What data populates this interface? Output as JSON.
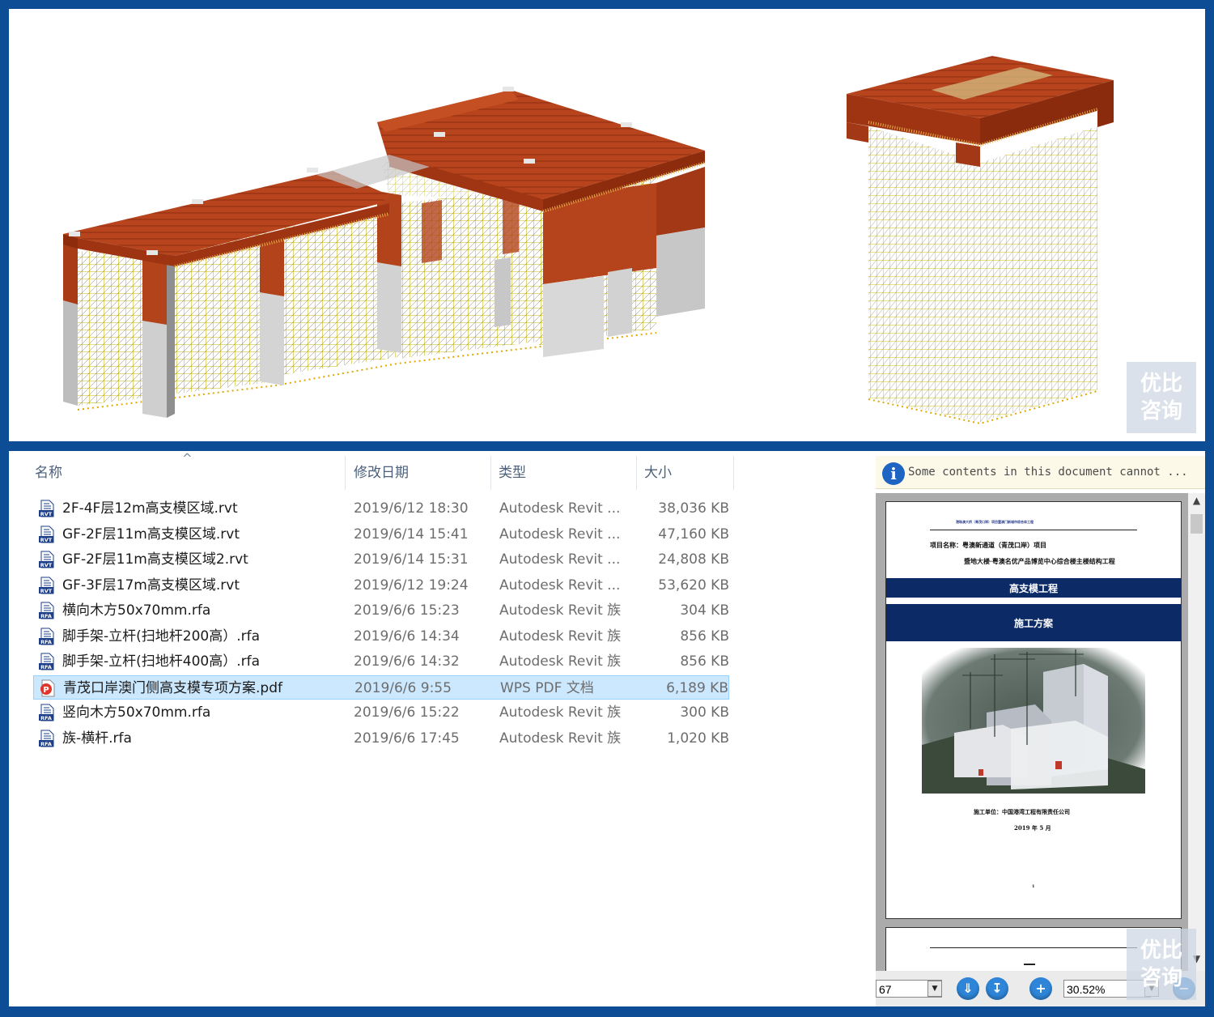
{
  "watermark": {
    "line1": "优比",
    "line2": "咨询"
  },
  "file_list": {
    "columns": {
      "name": "名称",
      "date": "修改日期",
      "type": "类型",
      "size": "大小"
    },
    "rows": [
      {
        "icon": "RVT",
        "name": "2F-4F层12m高支模区域.rvt",
        "date": "2019/6/12 18:30",
        "type": "Autodesk Revit ...",
        "size": "38,036 KB"
      },
      {
        "icon": "RVT",
        "name": "GF-2F层11m高支模区域.rvt",
        "date": "2019/6/14 15:41",
        "type": "Autodesk Revit ...",
        "size": "47,160 KB"
      },
      {
        "icon": "RVT",
        "name": "GF-2F层11m高支模区域2.rvt",
        "date": "2019/6/14 15:31",
        "type": "Autodesk Revit ...",
        "size": "24,808 KB"
      },
      {
        "icon": "RVT",
        "name": "GF-3F层17m高支模区域.rvt",
        "date": "2019/6/12 19:24",
        "type": "Autodesk Revit ...",
        "size": "53,620 KB"
      },
      {
        "icon": "RFA",
        "name": "横向木方50x70mm.rfa",
        "date": "2019/6/6 15:23",
        "type": "Autodesk Revit 族",
        "size": "304 KB"
      },
      {
        "icon": "RFA",
        "name": "脚手架-立杆(扫地杆200高）.rfa",
        "date": "2019/6/6 14:34",
        "type": "Autodesk Revit 族",
        "size": "856 KB"
      },
      {
        "icon": "RFA",
        "name": "脚手架-立杆(扫地杆400高）.rfa",
        "date": "2019/6/6 14:32",
        "type": "Autodesk Revit 族",
        "size": "856 KB"
      },
      {
        "icon": "PDF",
        "name": "青茂口岸澳门侧高支模专项方案.pdf",
        "date": "2019/6/6 9:55",
        "type": "WPS PDF 文档",
        "size": "6,189 KB"
      },
      {
        "icon": "RFA",
        "name": "竖向木方50x70mm.rfa",
        "date": "2019/6/6 15:22",
        "type": "Autodesk Revit 族",
        "size": "300 KB"
      },
      {
        "icon": "RFA",
        "name": "族-横杆.rfa",
        "date": "2019/6/6 17:45",
        "type": "Autodesk Revit 族",
        "size": "1,020 KB"
      }
    ]
  },
  "preview": {
    "info_text": "Some contents in this document cannot ...",
    "info_icon": "info-icon",
    "page": {
      "header_small": "港珠澳大桥（青茂口岸）项目暨澳门新城市综合体工程",
      "project_line1": "项目名称：粤澳新通道（青茂口岸）项目",
      "project_line2": "暨地大楼·粤澳名优产品博览中心综合楼主楼结构工程",
      "band1": "高支模工程",
      "band2": "施工方案",
      "company": "施工单位：中国港湾工程有限责任公司",
      "date": "2019 年 5 月",
      "page_number": "1"
    },
    "toolbar": {
      "page_field": "67",
      "zoom_field": "30.52%"
    }
  },
  "colors": {
    "frame": "#0d4d96",
    "selected_row": "#cce8ff",
    "band": "#0c2a66",
    "accent": "#2f86d9"
  }
}
